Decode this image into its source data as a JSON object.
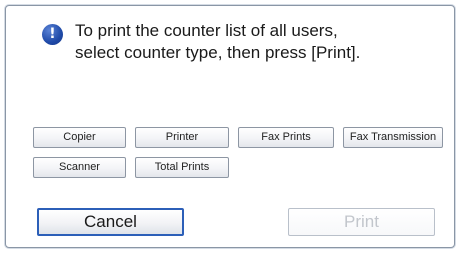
{
  "dialog": {
    "icon": "!",
    "message_line1": "To print the counter list of all users,",
    "message_line2": "select counter type, then press [Print]."
  },
  "counter_types": {
    "copier": "Copier",
    "printer": "Printer",
    "fax_prints": "Fax Prints",
    "fax_transmission": "Fax Transmission",
    "scanner": "Scanner",
    "total_prints": "Total Prints"
  },
  "actions": {
    "cancel": "Cancel",
    "print": "Print"
  },
  "icons": {
    "info": "exclamation-circle-icon"
  }
}
